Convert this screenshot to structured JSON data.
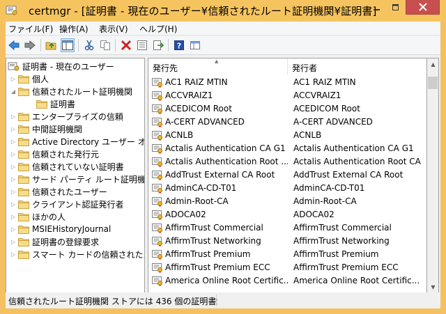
{
  "window": {
    "title": "certmgr - [証明書 - 現在のユーザー¥信頼されたルート証明機関¥証明書]",
    "accent": "#f6c45f",
    "close_color": "#c74f4f"
  },
  "menu": {
    "items": [
      "ファイル(F)",
      "操作(A)",
      "表示(V)",
      "ヘルプ(H)"
    ]
  },
  "toolbar": {
    "buttons": [
      "back-icon",
      "forward-icon",
      "up-folder-icon",
      "show-hide-tree-icon",
      "cut-icon",
      "copy-icon",
      "delete-icon",
      "properties-icon",
      "export-icon",
      "help-icon",
      "console-icon"
    ]
  },
  "tree": {
    "root": "証明書 - 現在のユーザー",
    "items": [
      {
        "label": "個人",
        "expanded": false
      },
      {
        "label": "信頼されたルート証明機関",
        "expanded": true
      },
      {
        "label": "証明書",
        "expanded": false,
        "child": true
      },
      {
        "label": "エンタープライズの信頼",
        "expanded": false
      },
      {
        "label": "中間証明機関",
        "expanded": false
      },
      {
        "label": "Active Directory ユーザー オブ",
        "expanded": false
      },
      {
        "label": "信頼された発行元",
        "expanded": false
      },
      {
        "label": "信頼されていない証明書",
        "expanded": false
      },
      {
        "label": "サード パーティ ルート証明機関",
        "expanded": false
      },
      {
        "label": "信頼されたユーザー",
        "expanded": false
      },
      {
        "label": "クライアント認証発行者",
        "expanded": false
      },
      {
        "label": "ほかの人",
        "expanded": false
      },
      {
        "label": "MSIEHistoryJournal",
        "expanded": false
      },
      {
        "label": "証明書の登録要求",
        "expanded": false
      },
      {
        "label": "スマート カードの信頼されたルート",
        "expanded": false
      }
    ]
  },
  "list": {
    "columns": [
      "発行先",
      "発行者"
    ],
    "rows": [
      [
        "AC1 RAIZ MTIN",
        "AC1 RAIZ MTIN"
      ],
      [
        "ACCVRAIZ1",
        "ACCVRAIZ1"
      ],
      [
        "ACEDICOM Root",
        "ACEDICOM Root"
      ],
      [
        "A-CERT ADVANCED",
        "A-CERT ADVANCED"
      ],
      [
        "ACNLB",
        "ACNLB"
      ],
      [
        "Actalis Authentication CA G1",
        "Actalis Authentication CA G1"
      ],
      [
        "Actalis Authentication Root ...",
        "Actalis Authentication Root CA"
      ],
      [
        "AddTrust External CA Root",
        "AddTrust External CA Root"
      ],
      [
        "AdminCA-CD-T01",
        "AdminCA-CD-T01"
      ],
      [
        "Admin-Root-CA",
        "Admin-Root-CA"
      ],
      [
        "ADOCA02",
        "ADOCA02"
      ],
      [
        "AffirmTrust Commercial",
        "AffirmTrust Commercial"
      ],
      [
        "AffirmTrust Networking",
        "AffirmTrust Networking"
      ],
      [
        "AffirmTrust Premium",
        "AffirmTrust Premium"
      ],
      [
        "AffirmTrust Premium ECC",
        "AffirmTrust Premium ECC"
      ],
      [
        "America Online Root Certific...",
        "America Online Root Certific..."
      ]
    ]
  },
  "status": {
    "text": "信頼されたルート証明機関 ストアには 436 個の証明書がありま"
  }
}
